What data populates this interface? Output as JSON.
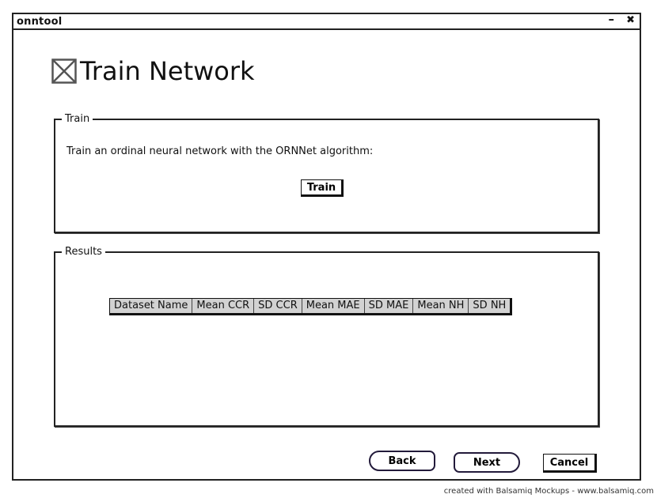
{
  "window": {
    "title": "onntool",
    "minimize_label": "–",
    "close_label": "✖"
  },
  "header": {
    "icon": "image-placeholder-icon",
    "title": "Train Network"
  },
  "train_panel": {
    "legend": "Train",
    "description": "Train an ordinal neural network with the ORNNet algorithm:",
    "train_button": "Train"
  },
  "results_panel": {
    "legend": "Results",
    "columns": [
      "Dataset Name",
      "Mean CCR",
      "SD CCR",
      "Mean MAE",
      "SD MAE",
      "Mean NH",
      "SD NH"
    ]
  },
  "footer": {
    "back": "Back",
    "next": "Next",
    "cancel": "Cancel"
  },
  "credit": "created with Balsamiq Mockups - www.balsamiq.com"
}
